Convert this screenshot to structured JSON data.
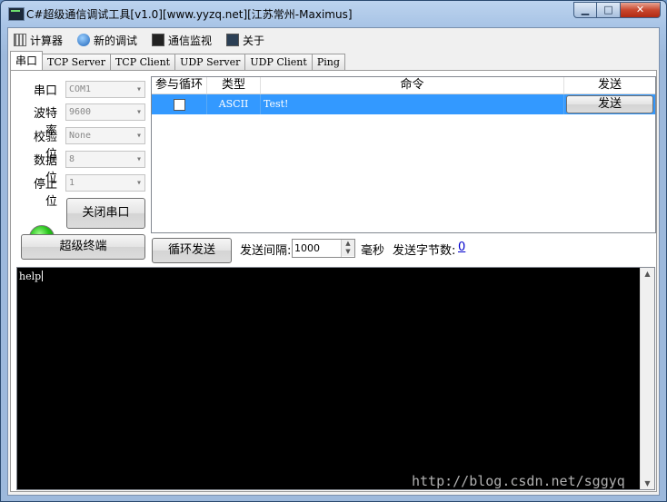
{
  "window": {
    "title": "C#超级通信调试工具[v1.0][www.yyzq.net][江苏常州-Maximus]",
    "min_glyph": "▁",
    "max_glyph": "□",
    "close_glyph": "✕"
  },
  "menu": [
    {
      "label": "计算器",
      "icon": "calculator-icon"
    },
    {
      "label": "新的调试",
      "icon": "new-debug-icon"
    },
    {
      "label": "通信监视",
      "icon": "monitor-icon"
    },
    {
      "label": "关于",
      "icon": "about-icon"
    }
  ],
  "tabs": [
    "串口",
    "TCP Server",
    "TCP Client",
    "UDP Server",
    "UDP Client",
    "Ping"
  ],
  "serial": {
    "port_label": "串口",
    "port_value": "COM1",
    "baud_label": "波特率",
    "baud_value": "9600",
    "parity_label": "校验位",
    "parity_value": "None",
    "databits_label": "数据位",
    "databits_value": "8",
    "stopbits_label": "停止位",
    "stopbits_value": "1",
    "close_button": "关闭串口",
    "terminal_button": "超级终端",
    "status_color": "#26c21a"
  },
  "grid": {
    "headers": [
      "参与循环",
      "类型",
      "命令",
      "发送"
    ],
    "rows": [
      {
        "loop": false,
        "type": "ASCII",
        "command": "Test!",
        "send_label": "发送"
      }
    ]
  },
  "send_bar": {
    "loop_send": "循环发送",
    "interval_label": "发送间隔:",
    "interval_value": "1000",
    "unit": "毫秒",
    "bytes_label": "发送字节数:",
    "bytes_value": "0"
  },
  "terminal": {
    "text": "help"
  },
  "watermark": "http://blog.csdn.net/sggyq"
}
